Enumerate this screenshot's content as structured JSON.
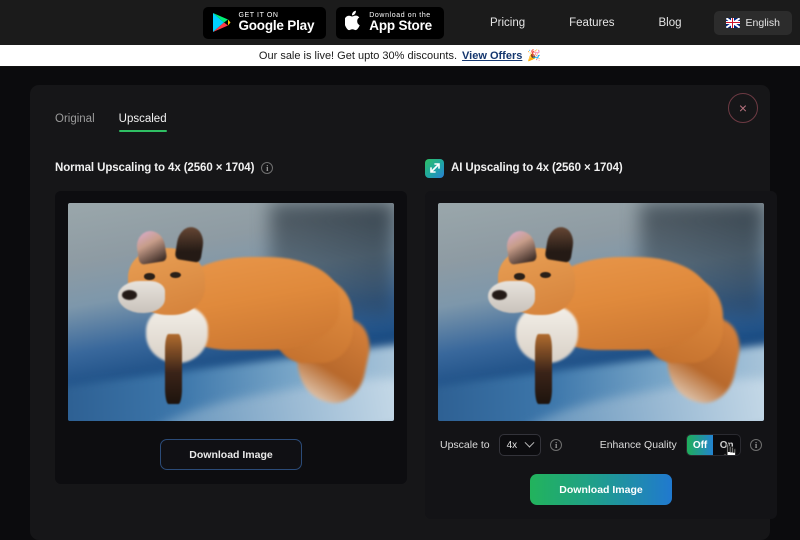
{
  "header": {
    "store_badges": [
      {
        "icon": "google-play-icon",
        "top_label": "GET IT ON",
        "bottom_label": "Google Play"
      },
      {
        "icon": "apple-icon",
        "top_label": "Download on the",
        "bottom_label": "App Store"
      }
    ],
    "nav_links": [
      "Pricing",
      "Features",
      "Blog"
    ],
    "language": {
      "label": "English",
      "icon": "uk-flag-icon"
    }
  },
  "banner": {
    "text": "Our sale is live! Get upto 30% discounts.",
    "link_label": "View Offers",
    "emoji": "🎉"
  },
  "modal": {
    "close_label": "×",
    "tabs": [
      {
        "label": "Original",
        "active": false
      },
      {
        "label": "Upscaled",
        "active": true
      }
    ],
    "left_panel": {
      "title": "Normal Upscaling to 4x (2560 × 1704)",
      "info_icon": "info-icon",
      "image_alt": "red fox standing on snow",
      "download_label": "Download Image"
    },
    "right_panel": {
      "icon": "ai-upscale-icon",
      "title": "AI Upscaling to 4x (2560 × 1704)",
      "image_alt": "red fox standing on snow upscaled",
      "controls": {
        "upscale_label": "Upscale to",
        "upscale_value": "4x",
        "upscale_info_icon": "info-icon",
        "enhance_label": "Enhance Quality",
        "toggle_on_label": "Off",
        "toggle_off_label": "On",
        "toggle_selected": "Off",
        "enhance_info_icon": "info-icon"
      },
      "download_label": "Download Image"
    }
  },
  "colors": {
    "accent_green": "#2fbf63",
    "accent_blue": "#2079cf",
    "close_red": "#b8737f",
    "link_blue": "#14366e"
  }
}
